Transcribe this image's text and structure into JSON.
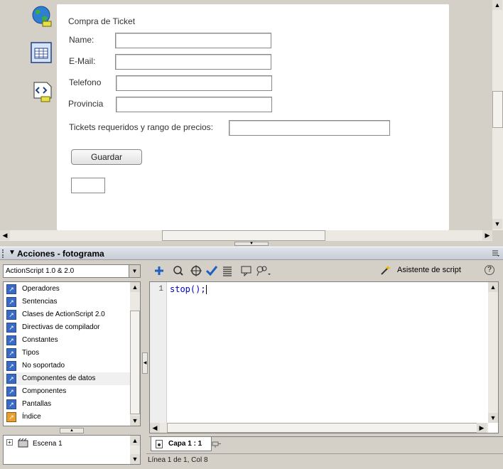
{
  "form": {
    "title": "Compra de Ticket",
    "fields": [
      {
        "label": "Name:",
        "value": ""
      },
      {
        "label": "E-Mail:",
        "value": ""
      },
      {
        "label": "Telefono",
        "value": ""
      },
      {
        "label": "Provincia",
        "value": ""
      }
    ],
    "tickets_label": "Tickets requeridos y rango de precios:",
    "tickets_value": "",
    "save_label": "Guardar",
    "small_box_value": ""
  },
  "side_tools": [
    {
      "icon": "globe-component-icon"
    },
    {
      "icon": "grid-component-icon"
    },
    {
      "icon": "code-component-icon"
    }
  ],
  "panel": {
    "title": "Acciones - fotograma",
    "language_selected": "ActionScript 1.0 & 2.0",
    "books": [
      {
        "label": "Operadores",
        "icon": "book-icon"
      },
      {
        "label": "Sentencias",
        "icon": "book-icon"
      },
      {
        "label": "Clases de ActionScript 2.0",
        "icon": "book-icon"
      },
      {
        "label": "Directivas de compilador",
        "icon": "book-icon"
      },
      {
        "label": "Constantes",
        "icon": "book-icon"
      },
      {
        "label": "Tipos",
        "icon": "book-icon"
      },
      {
        "label": "No soportado",
        "icon": "book-icon"
      },
      {
        "label": "Componentes de datos",
        "icon": "book-icon"
      },
      {
        "label": "Componentes",
        "icon": "book-icon"
      },
      {
        "label": "Pantallas",
        "icon": "book-icon"
      },
      {
        "label": "Índice",
        "icon": "index-icon"
      }
    ],
    "scene": "Escena 1",
    "script_assist_label": "Asistente de script",
    "code": {
      "line_number": "1",
      "text": "stop();"
    },
    "tab_label": "Capa 1 : 1",
    "status": "Línea 1 de 1, Col 8"
  },
  "colors": {
    "accent": "#3a6bc4",
    "panel_header": "#c7ccd6",
    "code_text": "#0000c0"
  }
}
